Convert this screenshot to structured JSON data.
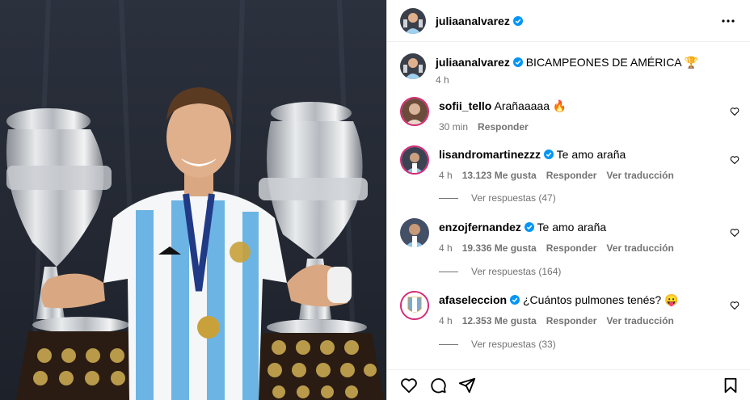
{
  "post": {
    "author": "juliaanalvarez",
    "caption": "BICAMPEONES DE AMÉRICA 🏆",
    "caption_time": "4 h"
  },
  "comments": [
    {
      "user": "sofii_tello",
      "verified": false,
      "text": "Arañaaaaa 🔥",
      "time": "30 min",
      "likes": "",
      "reply_label": "Responder",
      "translate_label": ""
    },
    {
      "user": "lisandromartinezzz",
      "verified": true,
      "text": "Te amo araña",
      "time": "4 h",
      "likes": "13.123 Me gusta",
      "reply_label": "Responder",
      "translate_label": "Ver traducción",
      "replies": "Ver respuestas (47)"
    },
    {
      "user": "enzojfernandez",
      "verified": true,
      "text": "Te amo araña",
      "time": "4 h",
      "likes": "19.336 Me gusta",
      "reply_label": "Responder",
      "translate_label": "Ver traducción",
      "replies": "Ver respuestas (164)"
    },
    {
      "user": "afaseleccion",
      "verified": true,
      "text": "¿Cuántos pulmones tenés? 😛",
      "time": "4 h",
      "likes": "12.353 Me gusta",
      "reply_label": "Responder",
      "translate_label": "Ver traducción",
      "replies": "Ver respuestas (33)"
    }
  ],
  "icons": {
    "more": "more-options-icon",
    "like": "heart-icon",
    "comment": "comment-icon",
    "share": "share-icon",
    "save": "bookmark-icon",
    "verified": "verified-badge-icon"
  },
  "colors": {
    "verified": "#0095f6",
    "meta": "#737373",
    "border": "#dbdbdb"
  }
}
